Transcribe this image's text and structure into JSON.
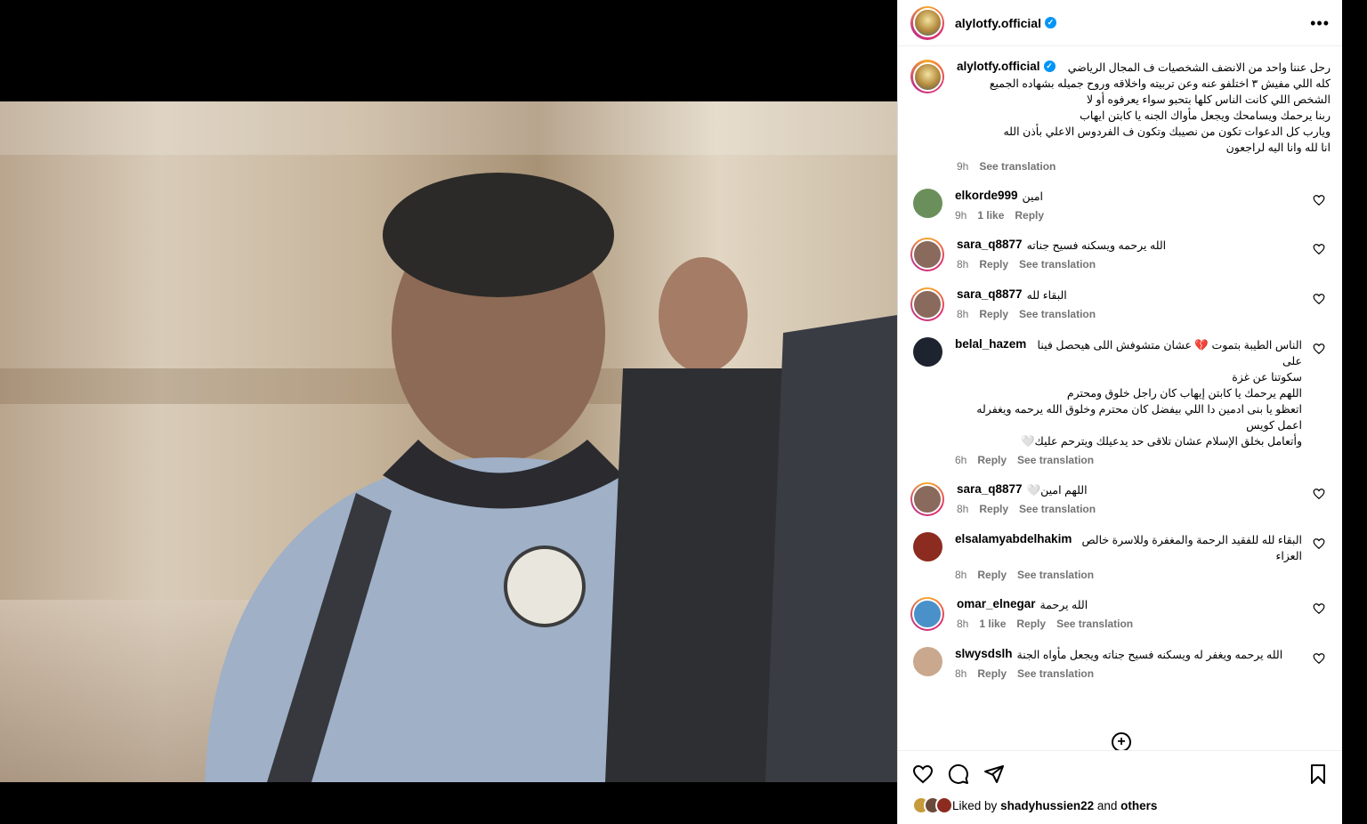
{
  "post": {
    "username": "alylotfy.official",
    "verified_icon": "verified-badge-icon",
    "more_icon": "more-options-icon",
    "more_label": "•••"
  },
  "caption": {
    "username": "alylotfy.official",
    "lines": [
      "رحل عننا واحد من الانضف الشخصيات ف المجال الرياضي",
      "كله اللي مفيش ٣ اختلفو عنه وعن تربيته واخلاقه وروح جميله بشهاده الجميع",
      "الشخص اللي كانت الناس كلها بتحبو سواء يعرفوه أو لا",
      "ربنا يرحمك ويسامحك ويجعل مأواك الجنه يا كابتن ايهاب",
      "ويارب كل الدعوات تكون من نصيبك وتكون ف الفردوس الاعلي بأذن الله",
      "انا لله وانا اليه لراجعون"
    ],
    "time": "9h",
    "see_translation": "See translation"
  },
  "comments": [
    {
      "username": "elkorde999",
      "text": "امين",
      "time": "9h",
      "likes": "1 like",
      "reply": "Reply",
      "translate": "",
      "avatar_color": "#6b8f5a",
      "ring": false
    },
    {
      "username": "sara_q8877",
      "text": "الله يرحمه ويسكنه فسيح جناته",
      "time": "8h",
      "likes": "",
      "reply": "Reply",
      "translate": "See translation",
      "avatar_color": "#8a6a5c",
      "ring": true
    },
    {
      "username": "sara_q8877",
      "text": "البقاء لله",
      "time": "8h",
      "likes": "",
      "reply": "Reply",
      "translate": "See translation",
      "avatar_color": "#8a6a5c",
      "ring": true
    },
    {
      "username": "belal_hazem",
      "text": "الناس الطيبة بتموت 💔 عشان متشوفش اللى هيحصل فينا على",
      "extra": [
        "سكوتنا عن غزة",
        "اللهم يرحمك يا كابتن إيهاب كان راجل خلوق ومحترم",
        "اتعظو يا بنى ادمين دا اللي بيفضل كان محترم وخلوق الله يرحمه ويغفرله اعمل كويس",
        "وأتعامل بخلق الإسلام عشان تلاقى حد يدعيلك ويترحم عليك🤍"
      ],
      "time": "6h",
      "likes": "",
      "reply": "Reply",
      "translate": "See translation",
      "avatar_color": "#1d2430",
      "ring": false
    },
    {
      "username": "sara_q8877",
      "text": "اللهم امين🤍",
      "time": "8h",
      "likes": "",
      "reply": "Reply",
      "translate": "See translation",
      "avatar_color": "#8a6a5c",
      "ring": true
    },
    {
      "username": "elsalamyabdelhakim",
      "text": "البقاء لله للفقيد الرحمة والمغفرة وللاسرة خالص العزاء",
      "time": "8h",
      "likes": "",
      "reply": "Reply",
      "translate": "See translation",
      "avatar_color": "#8c2b1f",
      "ring": false
    },
    {
      "username": "omar_elnegar",
      "text": "الله يرحمة",
      "time": "8h",
      "likes": "1 like",
      "reply": "Reply",
      "translate": "See translation",
      "avatar_color": "#4a90c9",
      "ring": true
    },
    {
      "username": "slwysdslh",
      "text": "الله يرحمه ويغفر له ويسكنه فسيح جناته ويجعل مأواه الجنة",
      "time": "8h",
      "likes": "",
      "reply": "Reply",
      "translate": "See translation",
      "avatar_color": "#c9a88e",
      "ring": false
    }
  ],
  "actions": {
    "like_icon": "heart-icon",
    "comment_icon": "comment-icon",
    "share_icon": "share-icon",
    "save_icon": "bookmark-icon",
    "load_more_icon": "plus-circle-icon",
    "load_more_label": "+"
  },
  "likes": {
    "prefix": "Liked by",
    "user": "shadyhussien22",
    "and": "and",
    "others": "others"
  },
  "colors": {
    "accent": "#0095f6",
    "muted": "#737373"
  }
}
